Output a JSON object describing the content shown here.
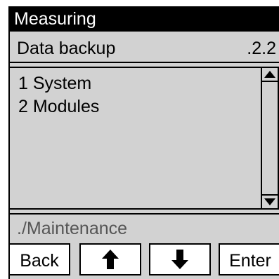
{
  "title": "Measuring",
  "header": {
    "label": "Data backup",
    "code": ".2.2"
  },
  "list": {
    "items": [
      {
        "label": "1 System"
      },
      {
        "label": "2 Modules"
      }
    ]
  },
  "path": "./Maintenance",
  "buttons": {
    "back": "Back",
    "up_icon": "arrow-up-icon",
    "down_icon": "arrow-down-icon",
    "enter": "Enter"
  },
  "colors": {
    "title_bg": "#000000",
    "title_fg": "#ffffff",
    "frame": "#d2d2d2",
    "path_text": "#555555"
  }
}
